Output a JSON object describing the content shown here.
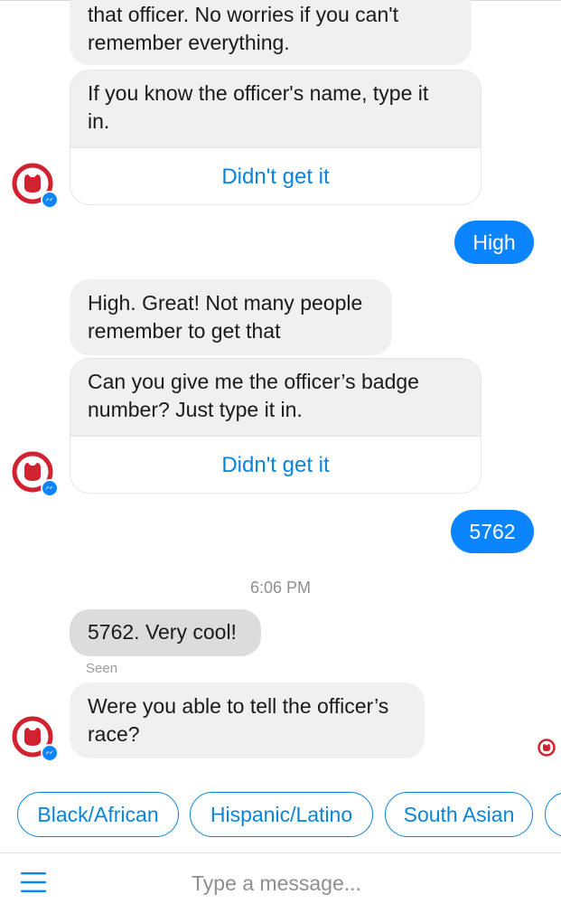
{
  "messages": {
    "bot_partial": "that officer. No worries if you can't remember everything.",
    "bot_partial_lines": [
      "that officer. No worries if you can't",
      "remember everything."
    ],
    "card1": {
      "lines": [
        "If you know the officer's name, type it",
        "in."
      ],
      "button": "Didn't get it"
    },
    "user1": "High",
    "bot2_lines": [
      "High. Great! Not many people",
      "remember to get that"
    ],
    "card2": {
      "lines": [
        "Can you give me the officer’s badge",
        "number? Just type it in."
      ],
      "button": "Didn't get it"
    },
    "user2": "5762",
    "timestamp": "6:06 PM",
    "bot3": "5762. Very cool!",
    "seen": "Seen",
    "bot4_lines": [
      "Were you able to tell the officer’s",
      "race?"
    ]
  },
  "quick_replies": [
    "Black/African",
    "Hispanic/Latino",
    "South Asian"
  ],
  "composer": {
    "placeholder": "Type a message..."
  },
  "colors": {
    "accent": "#0a84ff",
    "link": "#0a84d8",
    "bot_bubble": "#f1f0f0",
    "brand_red": "#d0222f",
    "messenger_badge": "#0a84ff"
  },
  "icons": {
    "avatar": "bot-avatar-icon",
    "badge": "messenger-badge-icon",
    "menu": "hamburger-menu-icon"
  }
}
